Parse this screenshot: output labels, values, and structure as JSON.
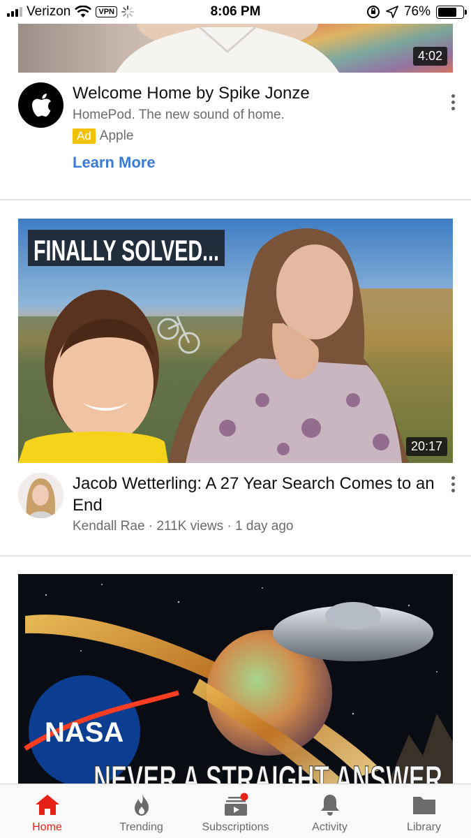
{
  "status_bar": {
    "carrier": "Verizon",
    "vpn": "VPN",
    "time": "8:06 PM",
    "battery": "76%",
    "battery_level": 0.76
  },
  "ad_card": {
    "duration": "4:02",
    "title": "Welcome Home by Spike Jonze",
    "subtitle": "HomePod. The new sound of home.",
    "ad_label": "Ad",
    "advertiser": "Apple",
    "cta": "Learn More",
    "avatar_icon": "apple-logo-icon"
  },
  "video_1": {
    "thumbnail_text": "FINALLY SOLVED...",
    "duration": "20:17",
    "title": "Jacob Wetterling: A 27 Year Search Comes to an End",
    "meta": "Kendall Rae · 211K views · 1 day ago"
  },
  "video_2": {
    "thumbnail_text_1": "NASA",
    "thumbnail_text_2": "NEVER A STRAIGHT ANSWER"
  },
  "nav": {
    "items": [
      {
        "label": "Home",
        "icon": "home-icon",
        "active": true
      },
      {
        "label": "Trending",
        "icon": "flame-icon",
        "active": false
      },
      {
        "label": "Subscriptions",
        "icon": "subscriptions-icon",
        "active": false
      },
      {
        "label": "Activity",
        "icon": "bell-icon",
        "active": false
      },
      {
        "label": "Library",
        "icon": "folder-icon",
        "active": false
      }
    ]
  },
  "colors": {
    "accent_red": "#e62117",
    "link_blue": "#3a7bd5",
    "ad_yellow": "#f2c200"
  }
}
